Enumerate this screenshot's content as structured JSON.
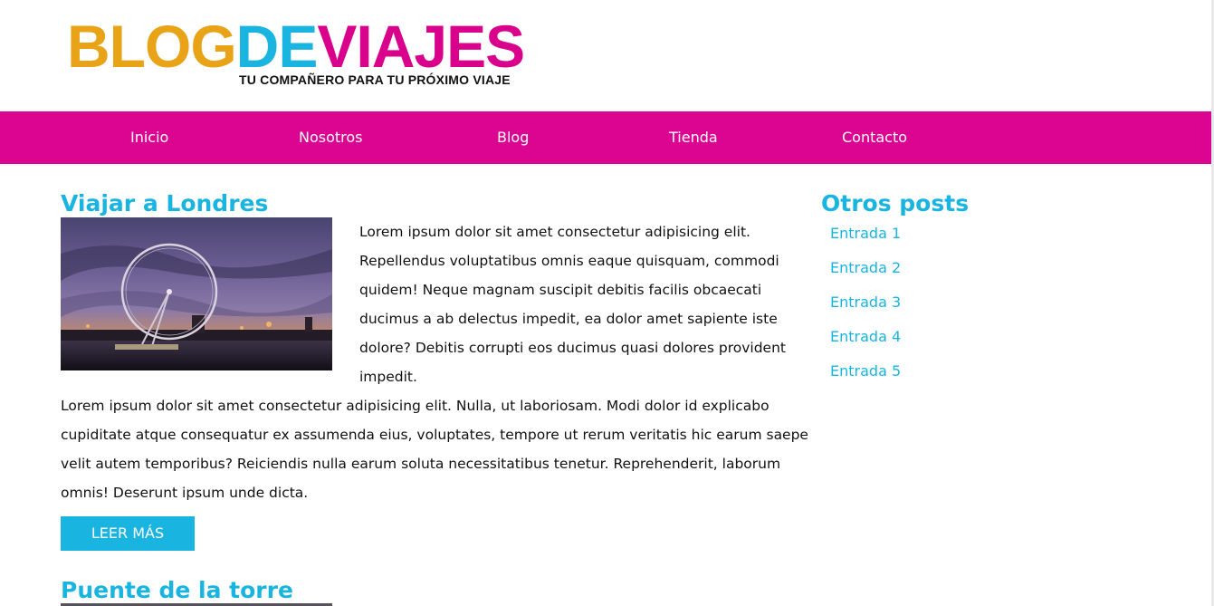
{
  "brand": {
    "part1": "BLOG",
    "part2": "DE",
    "part3": "VIAJES",
    "tagline": "TU COMPAÑERO PARA TU PRÓXIMO VIAJE",
    "colors": {
      "orange": "#e8a317",
      "cyan": "#19b4e0",
      "magenta": "#d9008c"
    }
  },
  "nav": {
    "items": [
      {
        "label": "Inicio"
      },
      {
        "label": "Nosotros"
      },
      {
        "label": "Blog"
      },
      {
        "label": "Tienda"
      },
      {
        "label": "Contacto"
      }
    ],
    "background": "#db0591"
  },
  "main": {
    "article": {
      "title": "Viajar a Londres",
      "image": "london-eye-photo",
      "paragraph1": "Lorem ipsum dolor sit amet consectetur adipisicing elit. Repellendus voluptatibus omnis eaque quisquam, commodi quidem! Neque magnam suscipit debitis facilis obcaecati ducimus a ab delectus impedit, ea dolor amet sapiente iste dolore? Debitis corrupti eos ducimus quasi dolores provident impedit.",
      "paragraph2": "Lorem ipsum dolor sit amet consectetur adipisicing elit. Nulla, ut laboriosam. Modi dolor id explicabo cupiditate atque consequatur ex assumenda eius, voluptates, tempore ut rerum veritatis hic earum saepe velit autem temporibus? Reiciendis nulla earum soluta necessitatibus tenetur. Reprehenderit, laborum omnis! Deserunt ipsum unde dicta.",
      "read_more": "LEER MÁS"
    },
    "article2": {
      "title": "Puente de la torre"
    }
  },
  "sidebar": {
    "title": "Otros posts",
    "items": [
      {
        "label": "Entrada 1"
      },
      {
        "label": "Entrada 2"
      },
      {
        "label": "Entrada 3"
      },
      {
        "label": "Entrada 4"
      },
      {
        "label": "Entrada 5"
      }
    ]
  }
}
